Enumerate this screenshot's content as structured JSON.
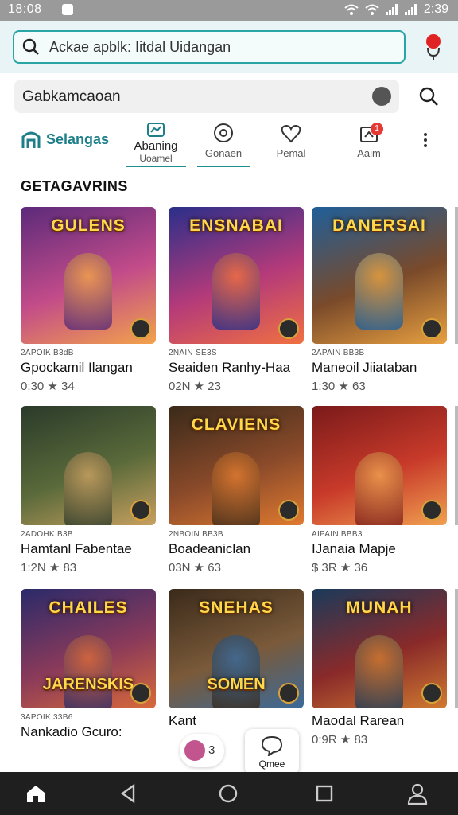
{
  "status_bar": {
    "time": "18:08",
    "clock": "2:39"
  },
  "search": {
    "placeholder": "Ackae apblk: Iitdal Uidangan"
  },
  "filter": {
    "value": "Gabkamcaoan"
  },
  "tabs": [
    {
      "label": "Selangas"
    },
    {
      "label_line1": "Abaning",
      "label_line2": "Uoamel"
    },
    {
      "label": "Gonaen"
    },
    {
      "label": "Pemal"
    },
    {
      "label": "Aaim",
      "badge": "1"
    }
  ],
  "section_title": "GETAGAVRINS",
  "games": [
    {
      "art_title": "GULENS",
      "meta": "2APOIK B3dB",
      "name": "Gpockamil Ilangan",
      "stats": "0:30 ★ 34",
      "colors": [
        "#5b2a7a",
        "#c24b8a",
        "#f2a24a"
      ]
    },
    {
      "art_title": "ENSNABAI",
      "meta": "2NAIN SE3S",
      "name": "Seaiden Ranhy-Haa",
      "stats": "02N ★ 23",
      "colors": [
        "#2a2f8a",
        "#b43a7a",
        "#f07040"
      ]
    },
    {
      "art_title": "DANERSAI",
      "meta": "2APAIN BB3B",
      "name": "Maneoil Jiiataban",
      "stats": "1:30 ★ 63",
      "colors": [
        "#1f5f9a",
        "#7a4a2a",
        "#e8a040"
      ]
    },
    {
      "art_title": "",
      "meta": "2ADOHK B3B",
      "name": "Hamtanl Fabentae",
      "stats": "1:2N ★ 83",
      "colors": [
        "#2a3a2a",
        "#5a6a3a",
        "#c8a060"
      ]
    },
    {
      "art_title": "CLAVIENS",
      "meta": "2NBOIN BB3B",
      "name": "Boadeaniclan",
      "stats": "03N ★ 63",
      "colors": [
        "#3a2a1a",
        "#8a4a2a",
        "#e07a30"
      ]
    },
    {
      "art_title": "",
      "meta": "AIPAIN BBB3",
      "name": "IJanaia Mapje",
      "stats": "$ 3R ★ 36",
      "colors": [
        "#7a1a1a",
        "#c83a2a",
        "#f0a050"
      ]
    },
    {
      "art_title": "CHAILES",
      "art_sub": "JARENSKIS",
      "meta": "3APOIK 33B6",
      "name": "Nankadio Gcuro:",
      "stats": "",
      "colors": [
        "#2a2a6a",
        "#8a3a5a",
        "#d86a3a"
      ]
    },
    {
      "art_title": "SNEHAS",
      "art_sub": "SOMEN",
      "meta": "",
      "name": "Kant",
      "stats": "",
      "colors": [
        "#3a2a1a",
        "#7a5a3a",
        "#3a6a9a"
      ]
    },
    {
      "art_title": "MUNAH",
      "meta": "",
      "name": "Maodal Rarean",
      "stats": "0:9R ★ 83",
      "colors": [
        "#1a3a5a",
        "#8a2a2a",
        "#d07a30"
      ]
    }
  ],
  "floating": {
    "chip_count": "3",
    "fab_label": "Qmee"
  },
  "icons": [
    "search-icon",
    "mic-icon",
    "avatar-icon",
    "store-icon",
    "chart-icon",
    "chat-icon",
    "heart-icon",
    "bell-icon",
    "kebab-icon",
    "home-icon",
    "back-icon",
    "circle-home-icon",
    "recents-icon",
    "person-icon"
  ]
}
